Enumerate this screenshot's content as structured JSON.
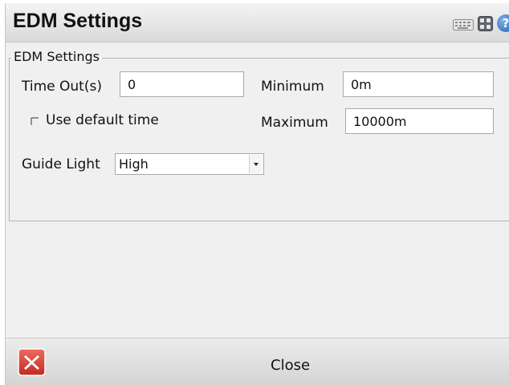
{
  "window": {
    "title": "EDM Settings",
    "title_icons": [
      "keyboard-icon",
      "settings-icon",
      "help-icon"
    ],
    "help_glyph": "?"
  },
  "group": {
    "legend": "EDM Settings"
  },
  "timeout": {
    "label": "Time Out(s)",
    "value": "0"
  },
  "use_default_time": {
    "label": "Use default time",
    "checked": false
  },
  "minimum": {
    "label": "Minimum",
    "value": "0m"
  },
  "maximum": {
    "label": "Maximum",
    "value": "10000m"
  },
  "guide_light": {
    "label": "Guide Light",
    "selected": "High"
  },
  "footer": {
    "close_label": "Close",
    "close_icon": "close-icon"
  },
  "colors": {
    "close_icon_red": "#d6312a",
    "help_icon_blue": "#1d5fb4"
  }
}
